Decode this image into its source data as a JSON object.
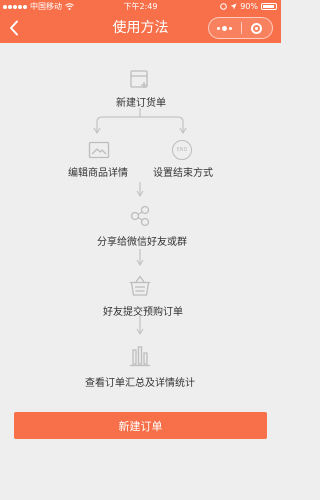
{
  "status_bar": {
    "carrier": "中国移动",
    "time": "下午2:49",
    "battery": "90%"
  },
  "nav": {
    "title": "使用方法"
  },
  "flow": {
    "step_new_order": "新建订货单",
    "step_edit_details": "编辑商品详情",
    "step_set_end": "设置结束方式",
    "end_icon_text": "END",
    "step_share": "分享给微信好友或群",
    "step_submit": "好友提交预购订单",
    "step_stats": "查看订单汇总及详情统计"
  },
  "actions": {
    "new_order_button": "新建订单"
  },
  "colors": {
    "accent": "#f7704a",
    "background": "#eeeeee",
    "icon_gray": "#c4c4c4"
  },
  "icons": {
    "back": "chevron-left-icon",
    "more": "more-dots-icon",
    "close": "close-circle-icon"
  }
}
